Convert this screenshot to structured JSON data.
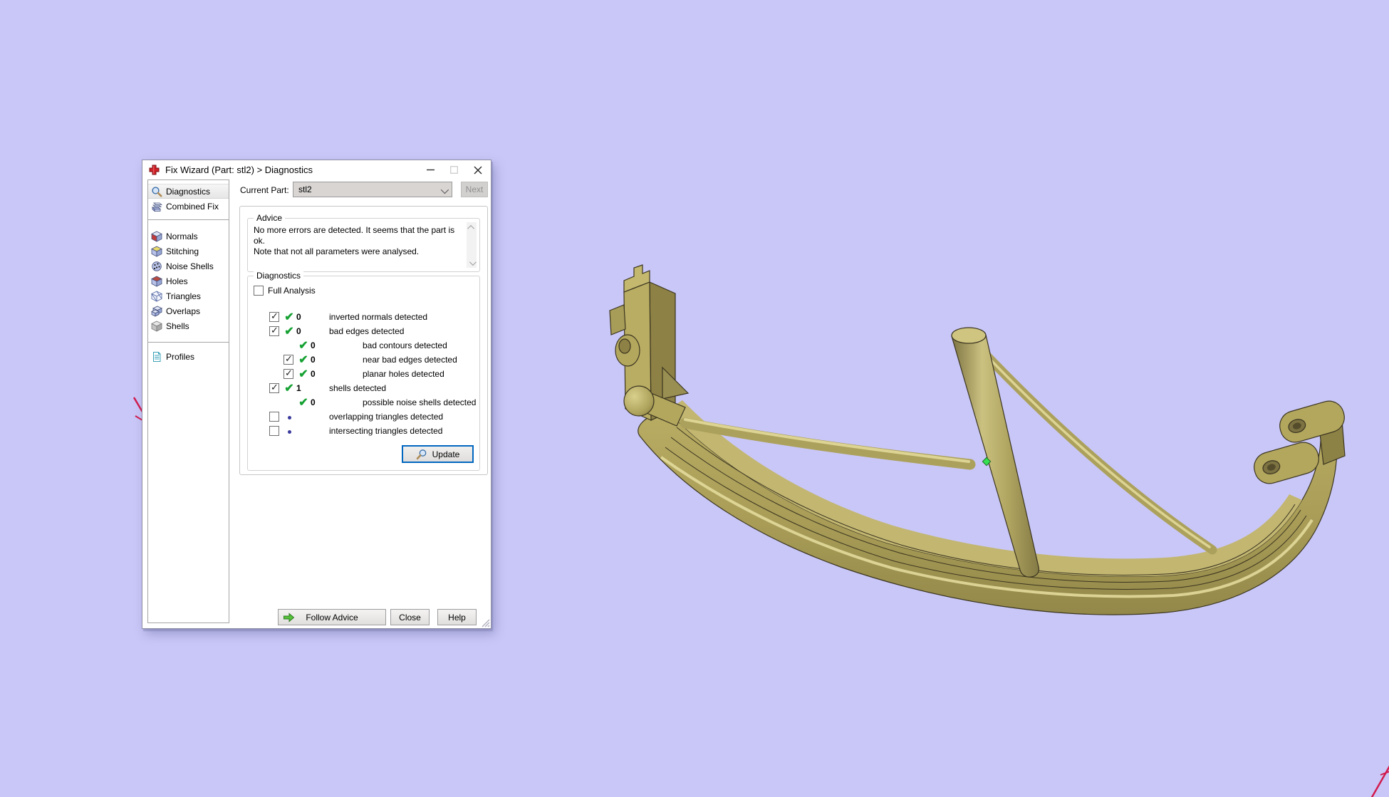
{
  "window": {
    "title": "Fix Wizard (Part: stl2) > Diagnostics"
  },
  "sidebar": {
    "items": [
      {
        "label": "Diagnostics",
        "icon": "magnifier-icon",
        "selected": true
      },
      {
        "label": "Combined Fix",
        "icon": "stacked-cubes-icon",
        "selected": false
      },
      {
        "label": "Normals",
        "icon": "cube-red-side-icon",
        "selected": false
      },
      {
        "label": "Stitching",
        "icon": "cube-yellow-top-icon",
        "selected": false
      },
      {
        "label": "Noise Shells",
        "icon": "dotted-sphere-icon",
        "selected": false
      },
      {
        "label": "Holes",
        "icon": "cube-red-top-icon",
        "selected": false
      },
      {
        "label": "Triangles",
        "icon": "wireframe-cube-icon",
        "selected": false
      },
      {
        "label": "Overlaps",
        "icon": "overlapping-cubes-icon",
        "selected": false
      },
      {
        "label": "Shells",
        "icon": "gray-cube-icon",
        "selected": false
      },
      {
        "label": "Profiles",
        "icon": "document-icon",
        "selected": false
      }
    ]
  },
  "toolbar": {
    "current_part_label": "Current Part:",
    "current_part_value": "stl2",
    "next_label": "Next"
  },
  "advice": {
    "title": "Advice",
    "text": "No more errors are detected. It seems that the part is ok.\nNote that not all parameters were analysed."
  },
  "diagnostics": {
    "title": "Diagnostics",
    "full_analysis_label": "Full Analysis",
    "update_label": "Update",
    "rows": [
      {
        "checkbox": true,
        "checked": true,
        "status": "ok",
        "count": "0",
        "label": "inverted normals detected",
        "indent": 0
      },
      {
        "checkbox": true,
        "checked": true,
        "status": "ok",
        "count": "0",
        "label": "bad edges detected",
        "indent": 0
      },
      {
        "checkbox": false,
        "checked": false,
        "status": "ok",
        "count": "0",
        "label": "bad contours detected",
        "indent": 1
      },
      {
        "checkbox": true,
        "checked": true,
        "status": "ok",
        "count": "0",
        "label": "near bad edges detected",
        "indent": 1
      },
      {
        "checkbox": true,
        "checked": true,
        "status": "ok",
        "count": "0",
        "label": "planar holes detected",
        "indent": 1
      },
      {
        "checkbox": true,
        "checked": true,
        "status": "ok",
        "count": "1",
        "label": "shells detected",
        "indent": 0
      },
      {
        "checkbox": false,
        "checked": false,
        "status": "ok",
        "count": "0",
        "label": "possible noise shells detected",
        "indent": 1
      },
      {
        "checkbox": true,
        "checked": false,
        "status": "dot",
        "count": "",
        "label": "overlapping triangles detected",
        "indent": 0
      },
      {
        "checkbox": true,
        "checked": false,
        "status": "dot",
        "count": "",
        "label": "intersecting triangles detected",
        "indent": 0
      }
    ]
  },
  "footer": {
    "follow_advice_label": "Follow Advice",
    "close_label": "Close",
    "help_label": "Help"
  },
  "colors": {
    "desktop_background": "#c9c7f7",
    "model_khaki": "#b3a75e",
    "model_shadow": "#8d8145",
    "update_focus_border": "#0067c0",
    "ok_check_green": "#16a133",
    "marker_green": "#35e052",
    "axis_red": "#d21b4e"
  }
}
